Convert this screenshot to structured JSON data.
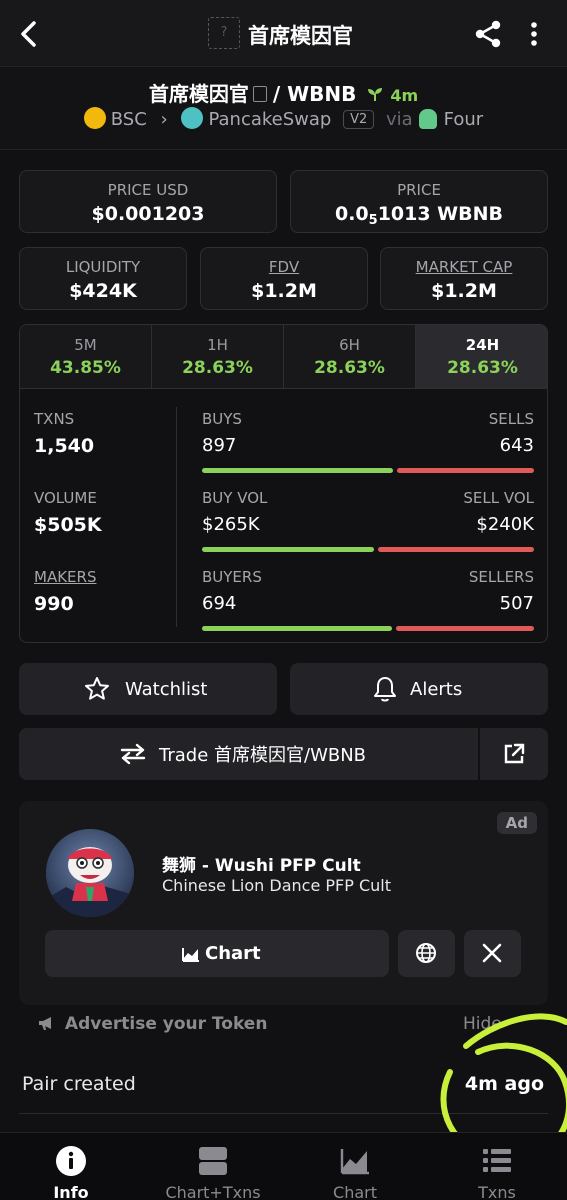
{
  "header": {
    "title": "首席模因官",
    "token_image_placeholder": "?"
  },
  "pair": {
    "base": "首席模因官",
    "separator": "/",
    "quote": "WBNB",
    "age": "4m",
    "chain": "BSC",
    "dex": "PancakeSwap",
    "version": "V2",
    "via_label": "via",
    "launchpad": "Four"
  },
  "prices": {
    "price_usd_label": "PRICE USD",
    "price_usd": "$0.001203",
    "price_label": "PRICE",
    "price_prefix": "0.0",
    "price_zeros": "5",
    "price_rest": "1013 WBNB"
  },
  "metrics": [
    {
      "label": "LIQUIDITY",
      "value": "$424K"
    },
    {
      "label": "FDV",
      "value": "$1.2M"
    },
    {
      "label": "MARKET CAP",
      "value": "$1.2M"
    }
  ],
  "timeframes": [
    {
      "label": "5M",
      "change": "43.85%"
    },
    {
      "label": "1H",
      "change": "28.63%"
    },
    {
      "label": "6H",
      "change": "28.63%"
    },
    {
      "label": "24H",
      "change": "28.63%"
    }
  ],
  "stats": {
    "txns_label": "TXNS",
    "txns": "1,540",
    "buys_label": "BUYS",
    "buys": "897",
    "sells_label": "SELLS",
    "sells": "643",
    "volume_label": "VOLUME",
    "volume": "$505K",
    "buy_vol_label": "BUY VOL",
    "buy_vol": "$265K",
    "sell_vol_label": "SELL VOL",
    "sell_vol": "$240K",
    "makers_label": "MAKERS",
    "makers": "990",
    "buyers_label": "BUYERS",
    "buyers": "694",
    "sellers_label": "SELLERS",
    "sellers": "507",
    "buy_share_txns": 0.582,
    "buy_share_vol": 0.525,
    "buy_share_makers": 0.578
  },
  "actions": {
    "watchlist": "Watchlist",
    "alerts": "Alerts",
    "trade": "Trade 首席模因官/WBNB"
  },
  "ad": {
    "tag": "Ad",
    "name": "舞狮 - Wushi PFP Cult",
    "description": "Chinese Lion Dance PFP Cult",
    "chart_button": "Chart"
  },
  "advertise": {
    "label": "Advertise your Token",
    "hide": "Hide"
  },
  "pair_created": {
    "label": "Pair created",
    "value": "4m ago"
  },
  "bottom_nav": [
    {
      "label": "Info"
    },
    {
      "label": "Chart+Txns"
    },
    {
      "label": "Chart"
    },
    {
      "label": "Txns"
    }
  ],
  "colors": {
    "positive": "#8bd15a",
    "negative": "#e05a5a",
    "highlight": "#c8f03a"
  }
}
